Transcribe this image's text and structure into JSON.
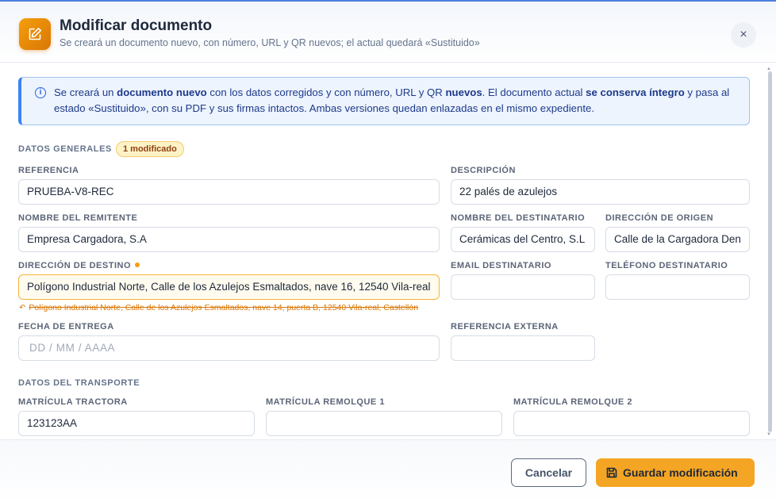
{
  "dialog": {
    "title": "Modificar documento",
    "subtitle": "Se creará un documento nuevo, con número, URL y QR nuevos; el actual quedará «Sustituido»",
    "close_glyph": "×",
    "header_icon": "edit-icon"
  },
  "info": {
    "icon": "info-icon",
    "icon_glyph": "i",
    "parts": [
      "Se creará un ",
      "documento nuevo",
      " con los datos corregidos y con número, URL y QR ",
      "nuevos",
      ". El documento actual ",
      "se conserva íntegro",
      " y pasa al estado «Sustituido», con su PDF y sus firmas intactos. Ambas versiones quedan enlazadas en el mismo expediente."
    ]
  },
  "general": {
    "section_title": "DATOS GENERALES",
    "badge": "1 modificado",
    "fields": {
      "referencia": {
        "label": "REFERENCIA",
        "value": "PRUEBA-V8-REC"
      },
      "descripcion": {
        "label": "DESCRIPCIÓN",
        "value": "22 palés de azulejos"
      },
      "remitente": {
        "label": "NOMBRE DEL REMITENTE",
        "value": "Empresa Cargadora, S.A"
      },
      "destinatario": {
        "label": "NOMBRE DEL DESTINATARIO",
        "value": "Cerámicas del Centro, S.L"
      },
      "origen": {
        "label": "DIRECCIÓN DE ORIGEN",
        "value": "Calle de la Cargadora Den"
      },
      "destino": {
        "label": "DIRECCIÓN DE DESTINO",
        "value": "Polígono Industrial Norte, Calle de los Azulejos Esmaltados, nave 16, 12540 Vila-real",
        "previous_value": "Polígono Industrial Norte, Calle de los Azulejos Esmaltados, nave 14, puerta B, 12540 Vila-real, Castellón",
        "previous_icon": "undo-icon",
        "previous_glyph": "↶"
      },
      "email": {
        "label": "EMAIL DESTINATARIO",
        "value": ""
      },
      "telefono": {
        "label": "TELÉFONO DESTINATARIO",
        "value": ""
      },
      "fecha": {
        "label": "FECHA DE ENTREGA",
        "placeholder": "DD / MM / AAAA"
      },
      "ref_externa": {
        "label": "REFERENCIA EXTERNA",
        "value": ""
      }
    }
  },
  "transport": {
    "section_title": "DATOS DEL TRANSPORTE",
    "fields": {
      "tractora": {
        "label": "MATRÍCULA TRACTORA",
        "value": "123123AA"
      },
      "remolque1": {
        "label": "MATRÍCULA REMOLQUE 1",
        "value": ""
      },
      "remolque2": {
        "label": "MATRÍCULA REMOLQUE 2",
        "value": ""
      }
    }
  },
  "footer": {
    "cancel_label": "Cancelar",
    "save_label": "Guardar modificación",
    "save_icon": "save-icon"
  },
  "colors": {
    "accent": "#f5a524",
    "info_border": "#3b82f6",
    "modified": "#f59e0b"
  }
}
